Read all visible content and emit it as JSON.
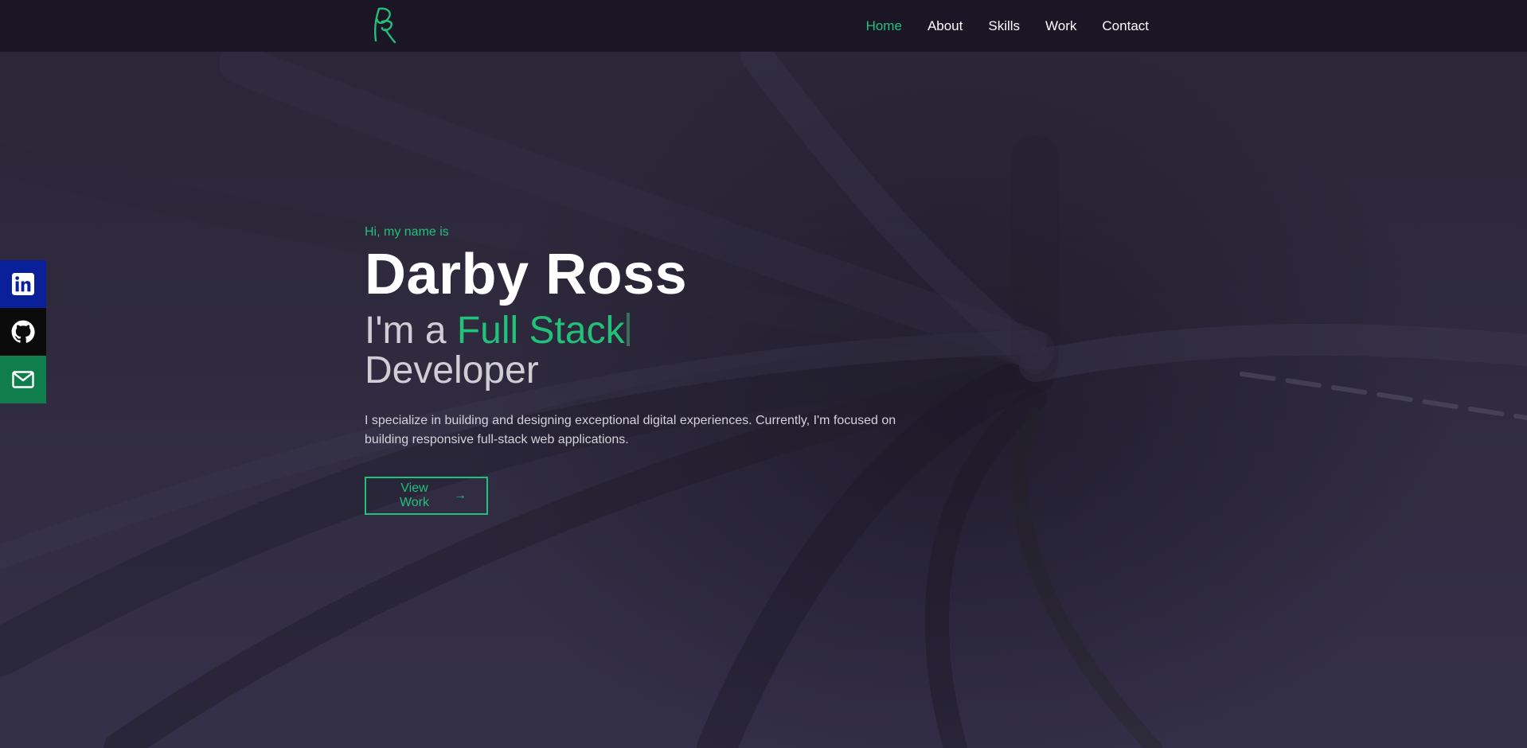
{
  "nav": {
    "logo_alt": "DR monogram logo",
    "links": [
      {
        "label": "Home",
        "active": true
      },
      {
        "label": "About",
        "active": false
      },
      {
        "label": "Skills",
        "active": false
      },
      {
        "label": "Work",
        "active": false
      },
      {
        "label": "Contact",
        "active": false
      }
    ]
  },
  "social": {
    "items": [
      {
        "name": "linkedin",
        "icon": "linkedin-icon",
        "color": "#0a1f9a"
      },
      {
        "name": "github",
        "icon": "github-icon",
        "color": "#0b0b0b"
      },
      {
        "name": "email",
        "icon": "mail-icon",
        "color": "#0f7d4c"
      }
    ]
  },
  "hero": {
    "greeting": "Hi, my name is",
    "name": "Darby Ross",
    "tagline_prefix": "I'm a ",
    "tagline_accent": "Full Stack",
    "tagline_suffix": "Developer",
    "description": "I specialize in building and designing exceptional digital experiences. Currently, I'm focused on building responsive full-stack web applications.",
    "cta_label": "View Work",
    "cta_icon": "arrow-right-icon"
  },
  "colors": {
    "accent": "#22c079",
    "navbar_bg": "#1b1626",
    "page_bg": "#2e2a3d"
  }
}
